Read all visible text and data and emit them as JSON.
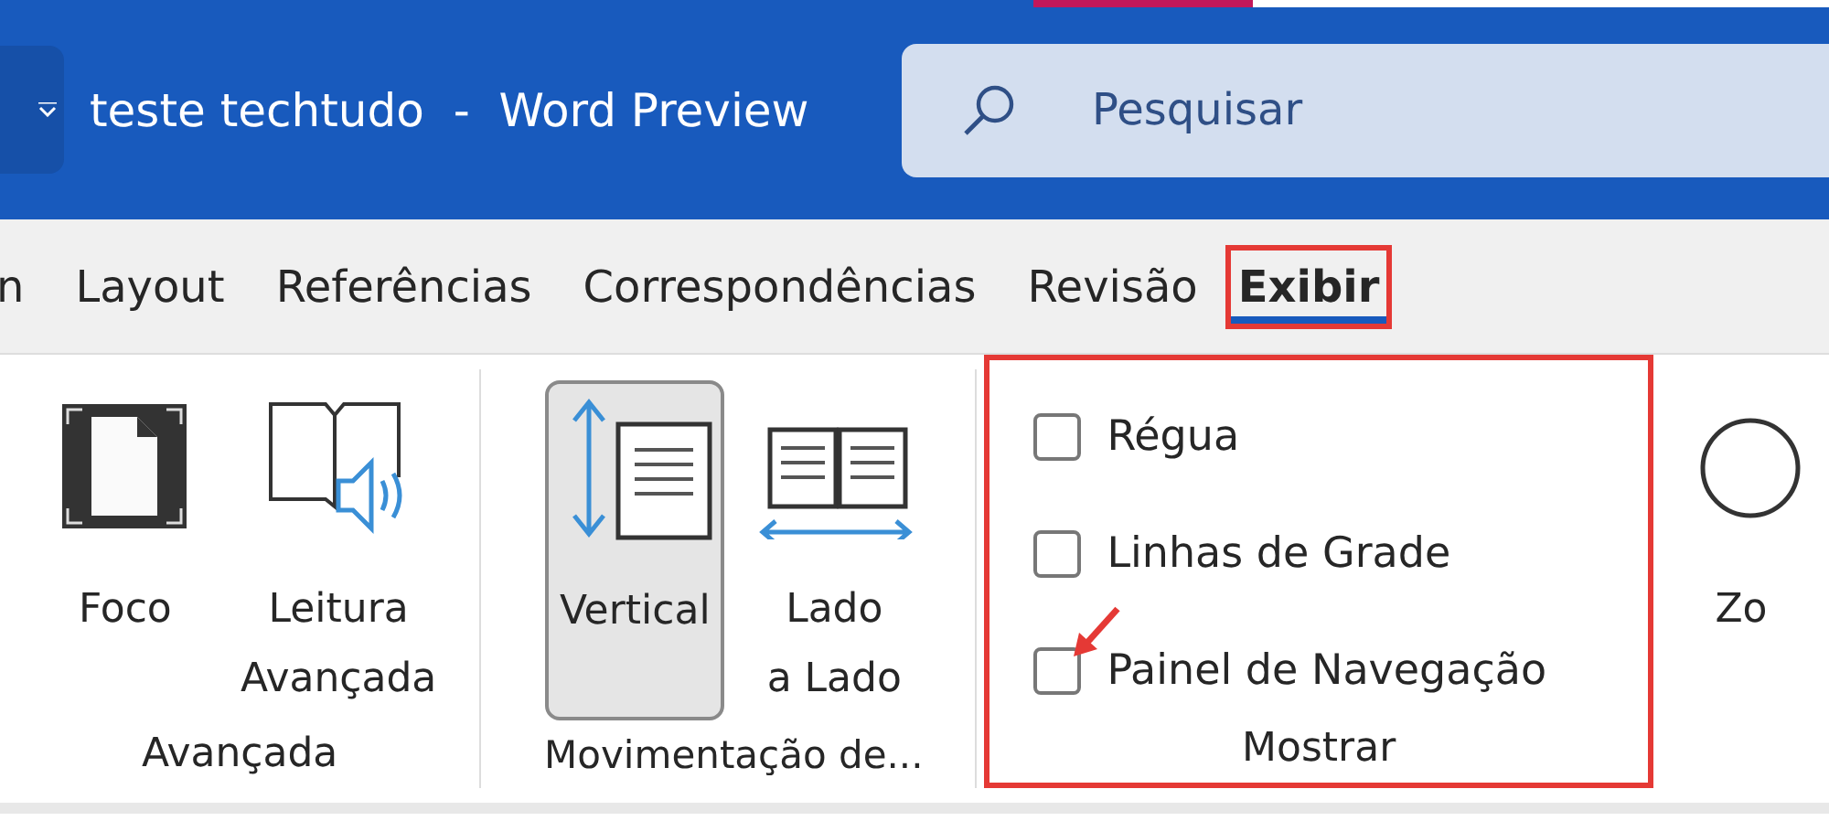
{
  "window": {
    "title": "teste techtudo  -  Word Preview"
  },
  "search": {
    "placeholder": "Pesquisar"
  },
  "tabs": [
    {
      "label": "n",
      "selected": false,
      "annotated": false
    },
    {
      "label": "Layout",
      "selected": false,
      "annotated": false
    },
    {
      "label": "Referências",
      "selected": false,
      "annotated": false
    },
    {
      "label": "Correspondências",
      "selected": false,
      "annotated": false
    },
    {
      "label": "Revisão",
      "selected": false,
      "annotated": false
    },
    {
      "label": "Exibir",
      "selected": true,
      "annotated": true
    }
  ],
  "ribbon": {
    "groups": [
      {
        "label": "Avançada",
        "annotated": false,
        "kind": "buttons",
        "commands": [
          {
            "lines": [
              "Foco"
            ],
            "selected": false
          },
          {
            "lines": [
              "Leitura",
              "Avançada"
            ],
            "selected": false
          }
        ]
      },
      {
        "label": "Movimentação de...",
        "annotated": false,
        "kind": "buttons",
        "commands": [
          {
            "lines": [
              "Vertical"
            ],
            "selected": true
          },
          {
            "lines": [
              "Lado",
              "a Lado"
            ],
            "selected": false
          }
        ]
      },
      {
        "label": "Mostrar",
        "annotated": true,
        "kind": "checks",
        "items": [
          {
            "label": "Régua",
            "checked": false,
            "pointed": false
          },
          {
            "label": "Linhas de Grade",
            "checked": false,
            "pointed": false
          },
          {
            "label": "Painel de Navegação",
            "checked": false,
            "pointed": true
          }
        ]
      },
      {
        "kind": "buttons",
        "commands": [
          {
            "lines": [
              "Zo"
            ],
            "selected": false
          }
        ]
      }
    ]
  }
}
